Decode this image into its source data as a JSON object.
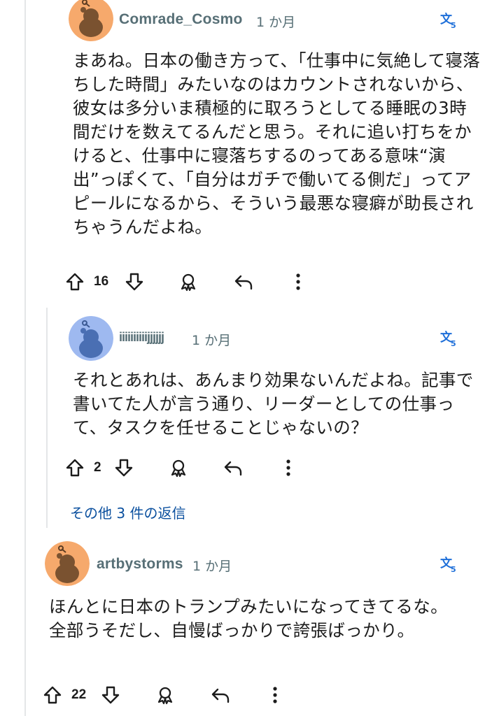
{
  "comments": [
    {
      "username": "Comrade_Cosmo",
      "time": "1 か月",
      "body": "まあね。日本の働き方って、「仕事中に気絶して寝落ちした時間」みたいなのはカウントされないから、彼女は多分いま積極的に取ろうとしてる睡眠の3時間だけを数えてるんだと思う。それに追い打ちをかけると、仕事中に寝落ちするのってある意味“演出”っぽくて、「自分はガチで働いてる側だ」ってアピールになるから、そういう最悪な寝癖が助長されちゃうんだよね。",
      "votes": "16",
      "avatar_color": "#f6a96c"
    },
    {
      "username": "iiiiiiiiiijjjjjj",
      "time": "1 か月",
      "body": "それとあれは、あんまり効果ないんだよね。記事で書いてた人が言う通り、リーダーとしての仕事って、タスクを任せることじゃないの？",
      "votes": "2",
      "avatar_color": "#9eb9f0"
    },
    {
      "username": "artbystorms",
      "time": "1 か月",
      "body": "ほんとに日本のトランプみたいになってきてるな。全部うそだし、自慢ばっかりで誇張ばっかり。",
      "votes": "22",
      "avatar_color": "#f6a96c"
    }
  ],
  "more_replies": "その他 3 件の返信",
  "icons": {
    "upvote": "arrow-up-outline",
    "downvote": "arrow-down-outline",
    "award": "award-ribbon",
    "reply": "reply-arrow",
    "more": "vertical-dots",
    "translate": "translate-glyph"
  },
  "colors": {
    "meta": "#576f76",
    "link": "#0a4f9e",
    "translate": "#1e6fd9"
  }
}
